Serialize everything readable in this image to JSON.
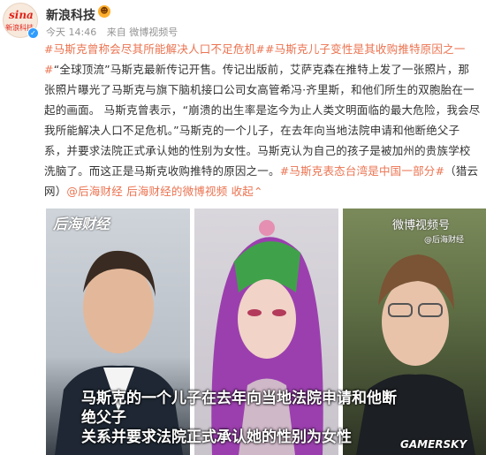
{
  "account": {
    "avatar_text_top": "sina",
    "avatar_text_bottom": "新浪科技",
    "name": "新浪科技",
    "meta_time": "今天 14:46",
    "meta_source": "来自 微博视频号"
  },
  "post": {
    "lines": [
      [
        {
          "t": "#马斯克曾称会尽其所能解决人口不足危机##马斯克儿子变性是其收购推特原因之一",
          "c": "topic"
        }
      ],
      [
        {
          "t": "#",
          "c": "topic"
        },
        {
          "t": "“全球顶流”马斯克最新传记开售。传记出版前，艾萨克森在推特上发了一张照片，那",
          "c": ""
        }
      ],
      [
        {
          "t": "张照片曝光了马斯克与旗下脑机接口公司女高管希冯·齐里斯，和他们所生的双胞胎在一",
          "c": ""
        }
      ],
      [
        {
          "t": "起的画面。 马斯克曾表示，“崩溃的出生率是迄今为止人类文明面临的最大危险，我会尽",
          "c": ""
        }
      ],
      [
        {
          "t": "我所能解决人口不足危机。”马斯克的一个儿子，在去年向当地法院申请和他断绝父子",
          "c": ""
        }
      ],
      [
        {
          "t": "系，并要求法院正式承认她的性别为女性。马斯克认为自己的孩子是被加州的贵族学校",
          "c": ""
        }
      ],
      [
        {
          "t": "洗脑了。而这正是马斯克收购推特的原因之一。",
          "c": ""
        },
        {
          "t": "#马斯克表态台湾是中国一部分#",
          "c": "topic"
        },
        {
          "t": "（猎云",
          "c": ""
        }
      ],
      [
        {
          "t": "网）",
          "c": ""
        },
        {
          "t": "@后海财经",
          "c": "link"
        },
        {
          "t": " ",
          "c": ""
        },
        {
          "t": "后海财经的微博视频",
          "c": "link"
        },
        {
          "t": " 收起",
          "c": "link"
        },
        {
          "t": "⌃",
          "c": "link"
        }
      ]
    ]
  },
  "media": {
    "watermark_left": "后海财经",
    "watermark_right": "微博视频号",
    "watermark_right_sub": "@后海财经",
    "subtitle_line1": "马斯克的一个儿子在去年向当地法院申请和他断绝父子",
    "subtitle_line2": "关系并要求法院正式承认她的性别为女性",
    "corner_watermark": "GAMERSKY"
  },
  "colors": {
    "topic": "#eb7350",
    "text": "#333333",
    "meta": "#939393"
  }
}
